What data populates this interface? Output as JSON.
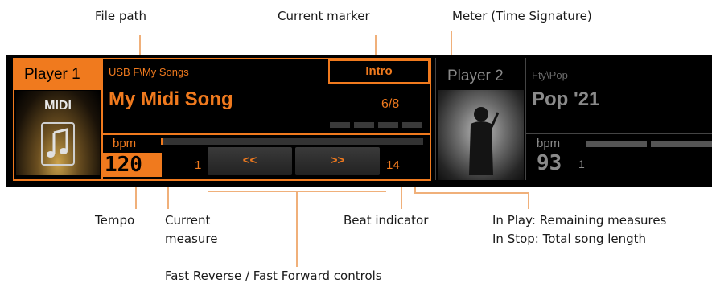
{
  "callouts": {
    "file_path": "File path",
    "current_marker": "Current marker",
    "meter": "Meter (Time Signature)",
    "tempo": "Tempo",
    "current_measure_1": "Current",
    "current_measure_2": "measure",
    "beat_indicator": "Beat indicator",
    "remaining_1": "In Play: Remaining measures",
    "remaining_2": "In Stop: Total song length",
    "fast_controls": "Fast Reverse / Fast Forward controls"
  },
  "player1": {
    "label": "Player 1",
    "file_type": "MIDI",
    "path": "USB F\\My Songs",
    "marker": "Intro",
    "song": "My Midi Song",
    "meter": "6/8",
    "bpm_label": "bpm",
    "tempo": "120",
    "current_measure": "1",
    "rewind_label": "<<",
    "forward_label": ">>",
    "total_measures": "14"
  },
  "player2": {
    "label": "Player 2",
    "path": "Fty\\Pop",
    "song": "Pop '21",
    "bpm_label": "bpm",
    "tempo": "93",
    "current_measure": "1"
  },
  "colors": {
    "accent": "#f07a1e",
    "panel_bg": "#000000",
    "leader": "#f0b07a"
  }
}
